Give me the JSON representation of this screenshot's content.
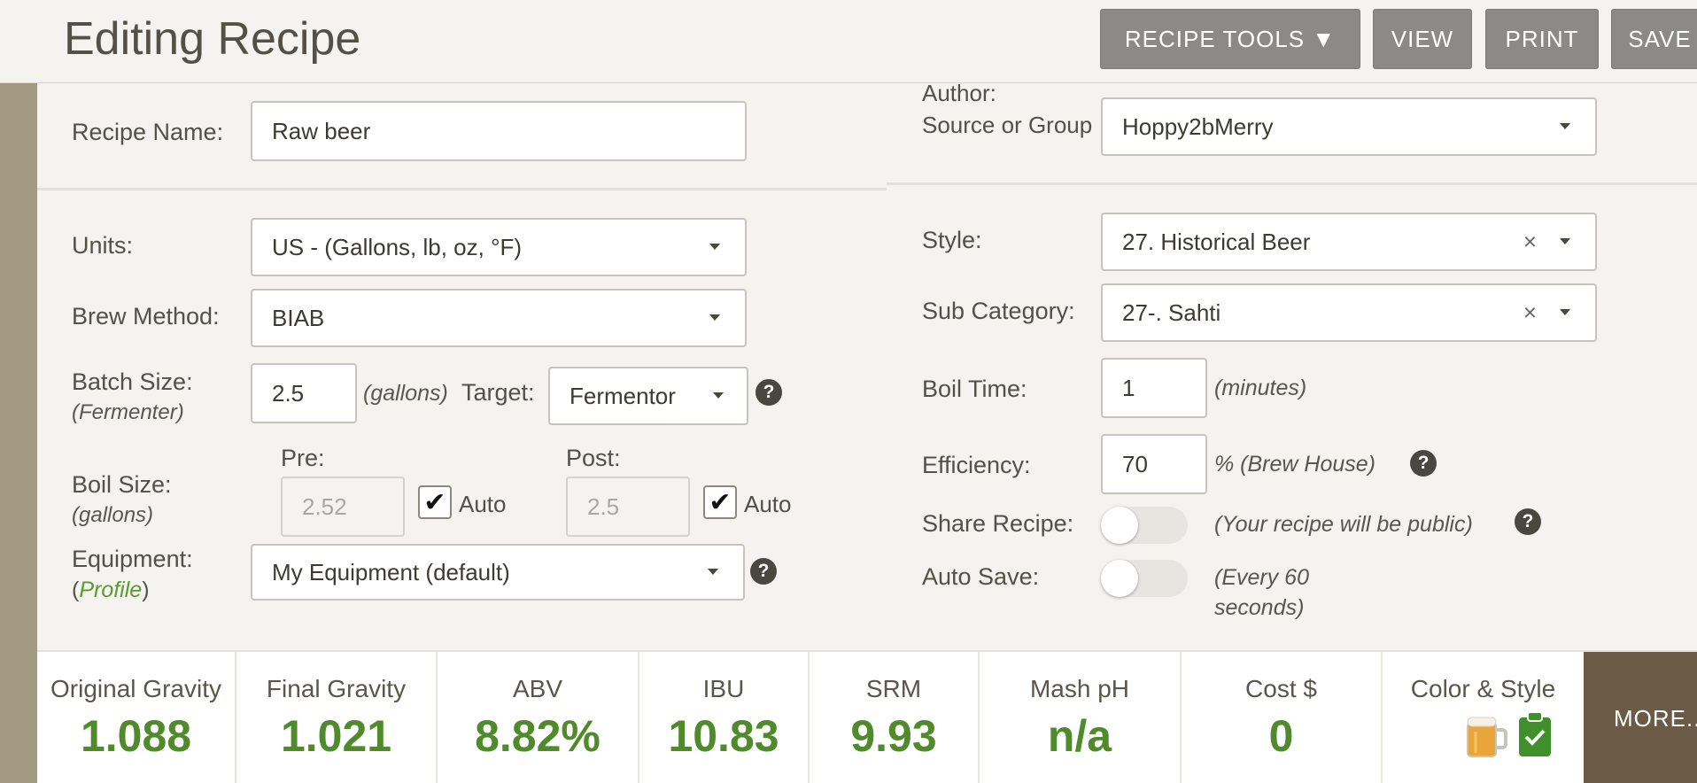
{
  "header": {
    "title": "Editing Recipe",
    "buttons": {
      "recipe_tools": "RECIPE TOOLS ▼",
      "view": "VIEW",
      "print": "PRINT",
      "save": "SAVE"
    }
  },
  "form": {
    "recipe_name": {
      "label": "Recipe Name:",
      "value": "Raw beer"
    },
    "author": {
      "label_line1": "Author:",
      "label_line2": "Source or Group",
      "value": "Hoppy2bMerry"
    },
    "units": {
      "label": "Units:",
      "value": "US - (Gallons, lb, oz, °F)"
    },
    "brew_method": {
      "label": "Brew Method:",
      "value": "BIAB"
    },
    "batch_size": {
      "label": "Batch Size:",
      "sublabel": "(Fermenter)",
      "value": "2.5",
      "unit": "(gallons)",
      "target_label": "Target:",
      "target_value": "Fermentor"
    },
    "boil_size": {
      "label": "Boil Size:",
      "sublabel": "(gallons)",
      "pre_label": "Pre:",
      "pre_value": "2.52",
      "pre_auto": "Auto",
      "post_label": "Post:",
      "post_value": "2.5",
      "post_auto": "Auto"
    },
    "equipment": {
      "label": "Equipment:",
      "paren_open": "(",
      "link": "Profile",
      "paren_close": ")",
      "value": "My Equipment (default)"
    },
    "style": {
      "label": "Style:",
      "value": "27. Historical Beer"
    },
    "sub_category": {
      "label": "Sub Category:",
      "value": "27-. Sahti"
    },
    "boil_time": {
      "label": "Boil Time:",
      "value": "1",
      "unit": "(minutes)"
    },
    "efficiency": {
      "label": "Efficiency:",
      "value": "70",
      "unit": "% (Brew House)"
    },
    "share_recipe": {
      "label": "Share Recipe:",
      "note": "(Your recipe will be public)"
    },
    "auto_save": {
      "label": "Auto Save:",
      "note_line1": "(Every 60",
      "note_line2": "seconds)"
    }
  },
  "stats": [
    {
      "label": "Original Gravity",
      "value": "1.088"
    },
    {
      "label": "Final Gravity",
      "value": "1.021"
    },
    {
      "label": "ABV",
      "value": "8.82%"
    },
    {
      "label": "IBU",
      "value": "10.83"
    },
    {
      "label": "SRM",
      "value": "9.93"
    },
    {
      "label": "Mash pH",
      "value": "n/a"
    },
    {
      "label": "Cost $",
      "value": "0"
    }
  ],
  "color_style": {
    "label": "Color & Style",
    "icons": [
      "beer-mug-icon",
      "clipboard-check-icon"
    ]
  },
  "more_button": "MORE..",
  "colors": {
    "accent_green": "#4f8a2b",
    "header_button": "#8c8a86",
    "more_button": "#6b5a45"
  }
}
